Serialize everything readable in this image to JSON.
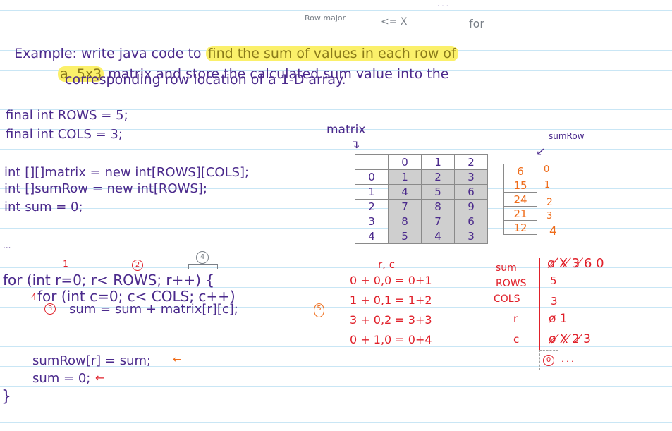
{
  "top_note": {
    "row_major": "Row major",
    "arrow_x": "<= X",
    "for_label": "for",
    "dots": ". . ."
  },
  "problem": {
    "line1_prefix": "Example: write java code to ",
    "line1_highlight": "find the sum of values in each row of",
    "line2_highlight": "a  5x3",
    "line2_rest": " matrix and store the calculated sum value into the",
    "line3": "corresponding row location of a 1-D array."
  },
  "code": {
    "decl_rows": "final int ROWS = 5;",
    "decl_cols": "final int COLS = 3;",
    "decl_matrix": "int [][]matrix = new int[ROWS][COLS];",
    "decl_sumrow": "int []sumRow = new int[ROWS];",
    "decl_sum": "int sum = 0;",
    "ellipsis": "...",
    "outer_for": "for (int r=0; r< ROWS; r++) {",
    "inner_for": "for (int c=0; c< COLS; c++)",
    "inner_prefix": "4",
    "body_sum": "sum = sum + matrix[r][c];",
    "assign_sumrow": "sumRow[r] = sum;",
    "reset_sum": "sum = 0;",
    "close_brace": "}",
    "step_marks": [
      "1",
      "2",
      "3",
      "4",
      "5"
    ],
    "arrow_mark": "←"
  },
  "matrix": {
    "label": "matrix",
    "col_headers": [
      "0",
      "1",
      "2"
    ],
    "row_headers": [
      "0",
      "1",
      "2",
      "3",
      "4"
    ],
    "values": [
      [
        "1",
        "2",
        "3"
      ],
      [
        "4",
        "5",
        "6"
      ],
      [
        "7",
        "8",
        "9"
      ],
      [
        "8",
        "7",
        "6"
      ],
      [
        "5",
        "4",
        "3"
      ]
    ]
  },
  "sum_row": {
    "label": "sumRow",
    "values": [
      "6",
      "15",
      "24",
      "21",
      "12"
    ],
    "indices": [
      "0",
      "1",
      "2",
      "3",
      "4"
    ]
  },
  "trace_calc": {
    "header": "r, c",
    "lines": [
      "0 + 0,0 = 0+1",
      "1 + 0,1 = 1+2",
      "3 + 0,2 = 3+3",
      "0 + 1,0 = 0+4"
    ]
  },
  "variable_trace": {
    "rows": [
      {
        "name": "sum",
        "values": "ø ̸X ̸3 ̸6 0"
      },
      {
        "name": "ROWS",
        "values": "5"
      },
      {
        "name": "COLS",
        "values": "3"
      },
      {
        "name": "r",
        "values": "ø 1"
      },
      {
        "name": "c",
        "values": "ø ̸X ̸2 ̸3"
      }
    ],
    "next_value": "0",
    "next_ellipsis": ". . ."
  }
}
